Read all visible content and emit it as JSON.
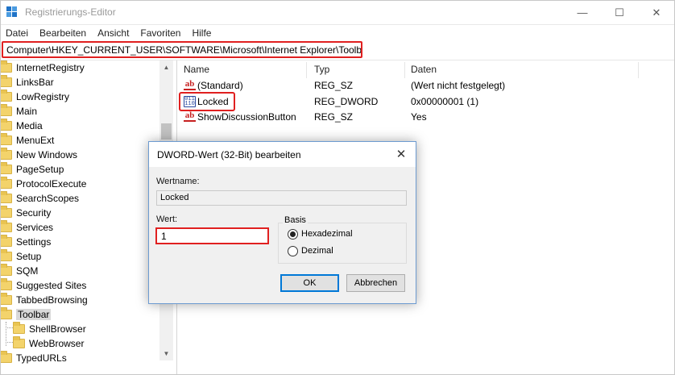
{
  "window": {
    "title": "Registrierungs-Editor",
    "minimize": "—",
    "maximize": "☐",
    "close": "✕"
  },
  "menu": [
    "Datei",
    "Bearbeiten",
    "Ansicht",
    "Favoriten",
    "Hilfe"
  ],
  "address": "Computer\\HKEY_CURRENT_USER\\SOFTWARE\\Microsoft\\Internet Explorer\\Toolbar",
  "tree": {
    "items": [
      "InternetRegistry",
      "LinksBar",
      "LowRegistry",
      "Main",
      "Media",
      "MenuExt",
      "New Windows",
      "PageSetup",
      "ProtocolExecute",
      "SearchScopes",
      "Security",
      "Services",
      "Settings",
      "Setup",
      "SQM",
      "Suggested Sites",
      "TabbedBrowsing",
      "Toolbar"
    ],
    "children": [
      "ShellBrowser",
      "WebBrowser"
    ],
    "after": "TypedURLs"
  },
  "list": {
    "columns": [
      "Name",
      "Typ",
      "Daten"
    ],
    "rows": [
      {
        "name": "(Standard)",
        "type": "REG_SZ",
        "data": "(Wert nicht festgelegt)",
        "icon": "string-value-icon"
      },
      {
        "name": "Locked",
        "type": "REG_DWORD",
        "data": "0x00000001 (1)",
        "icon": "binary-value-icon"
      },
      {
        "name": "ShowDiscussionButton",
        "type": "REG_SZ",
        "data": "Yes",
        "icon": "string-value-icon"
      }
    ]
  },
  "dialog": {
    "title": "DWORD-Wert (32-Bit) bearbeiten",
    "close": "✕",
    "name_label": "Wertname:",
    "name_value": "Locked",
    "value_label": "Wert:",
    "value": "1",
    "base_label": "Basis",
    "radio_hex": "Hexadezimal",
    "radio_dec": "Dezimal",
    "selected_base": "Hexadezimal",
    "ok": "OK",
    "cancel": "Abbrechen"
  },
  "colors": {
    "highlight": "#e02020",
    "accent": "#0078d7",
    "folder": "#f3d36b"
  }
}
